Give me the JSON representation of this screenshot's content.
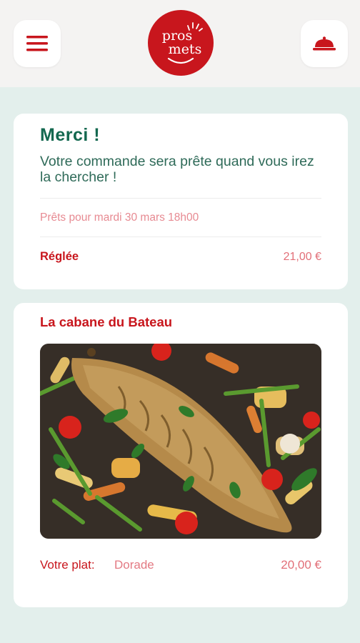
{
  "header": {
    "logo_line1": "pros",
    "logo_line2": "mets",
    "menu_icon": "hamburger-menu-icon",
    "cart_icon": "cloche-icon"
  },
  "confirmation": {
    "title": "Merci !",
    "message": "Votre commande sera prête quand vous irez la chercher !",
    "pickup": "Prêts pour mardi 30 mars 18h00",
    "status": "Réglée",
    "amount": "21,00 €"
  },
  "order": {
    "restaurant": "La cabane du Bateau",
    "dish_label": "Votre plat:",
    "dish_name": "Dorade",
    "dish_price": "20,00 €"
  },
  "colors": {
    "brand_red": "#c8161d",
    "green": "#13684f",
    "background": "#e3efec"
  }
}
